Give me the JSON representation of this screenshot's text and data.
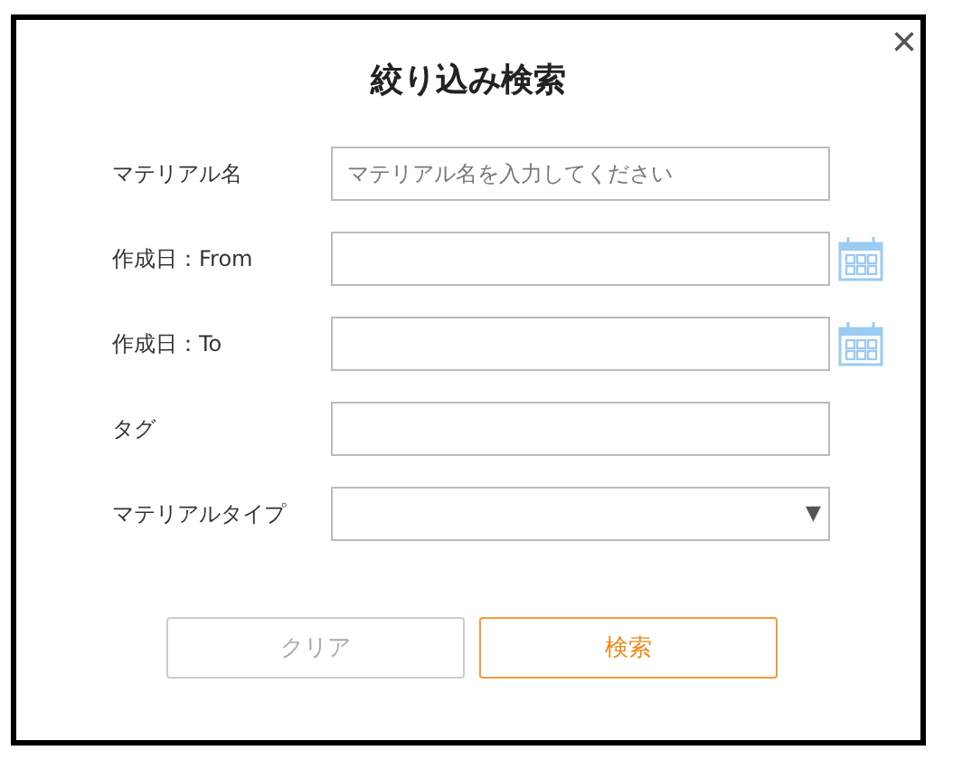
{
  "dialog": {
    "title": "絞り込み検索",
    "close": "×"
  },
  "fields": [
    {
      "label": "マテリアル名",
      "kind": "text",
      "placeholder": "マテリアル名を入力してください"
    },
    {
      "label": "作成日：From",
      "kind": "date"
    },
    {
      "label": "作成日：To",
      "kind": "date"
    },
    {
      "label": "タグ",
      "kind": "text"
    },
    {
      "label": "マテリアルタイプ",
      "kind": "select",
      "arrow": "▼"
    }
  ],
  "buttons": [
    {
      "label": "クリア",
      "kind": "secondary",
      "disabled": true
    },
    {
      "label": "検索",
      "kind": "primary",
      "disabled": false
    }
  ]
}
